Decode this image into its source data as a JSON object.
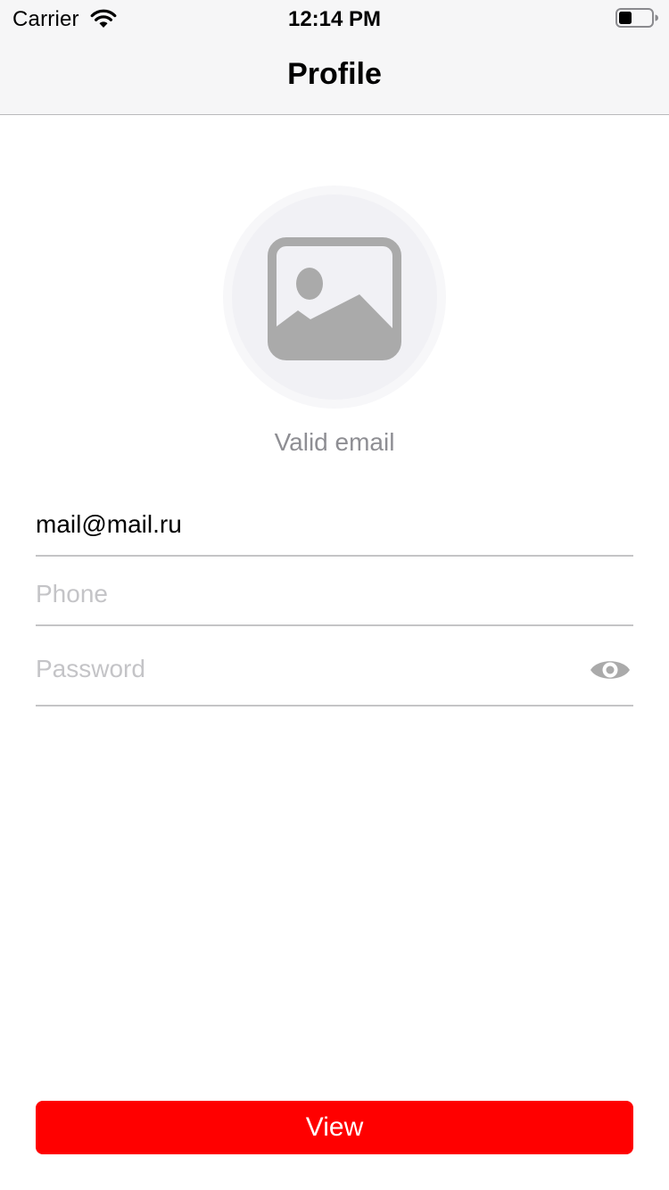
{
  "status_bar": {
    "carrier": "Carrier",
    "time": "12:14 PM",
    "icons": [
      "wifi-icon",
      "battery-icon"
    ]
  },
  "nav": {
    "title": "Profile"
  },
  "avatar": {
    "icon": "photo-placeholder-icon"
  },
  "email_status": "Valid email",
  "form": {
    "email": {
      "value": "mail@mail.ru",
      "placeholder": ""
    },
    "phone": {
      "value": "",
      "placeholder": "Phone"
    },
    "password": {
      "value": "",
      "placeholder": "Password",
      "toggle_icon": "eye-icon"
    }
  },
  "button": {
    "label": "View"
  },
  "colors": {
    "accent": "#ff0000",
    "nav_background": "#f6f6f7",
    "secondary_text": "#8e8e93",
    "placeholder_text": "#c4c4c7",
    "icon_gray": "#aaaaaa"
  }
}
